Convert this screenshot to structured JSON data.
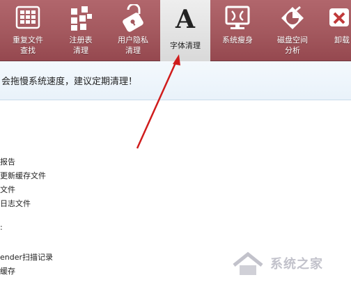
{
  "toolbar": {
    "items": [
      {
        "label": "重复文件\n查找",
        "icon": "grid-icon"
      },
      {
        "label": "注册表\n清理",
        "icon": "blocks-icon"
      },
      {
        "label": "用户隐私\n清理",
        "icon": "lock-icon"
      },
      {
        "label": "字体清理",
        "icon": "font-a-icon"
      },
      {
        "label": "系统瘦身",
        "icon": "monitor-icon"
      },
      {
        "label": "磁盘空间\n分析",
        "icon": "disk-pie-icon"
      },
      {
        "label": "卸载",
        "icon": "uninstall-icon"
      }
    ]
  },
  "info": {
    "message": "会拖慢系统速度，建议定期清理！"
  },
  "list": {
    "items": [
      "报告",
      "更新缓存文件",
      "文件",
      "日志文件",
      ":",
      "ender扫描记录",
      "缓存"
    ]
  },
  "watermark": {
    "text": "系统之家"
  },
  "colors": {
    "toolbar": "#a3585e",
    "arrow": "#d01c1c",
    "infobar": "#eef5fb"
  }
}
